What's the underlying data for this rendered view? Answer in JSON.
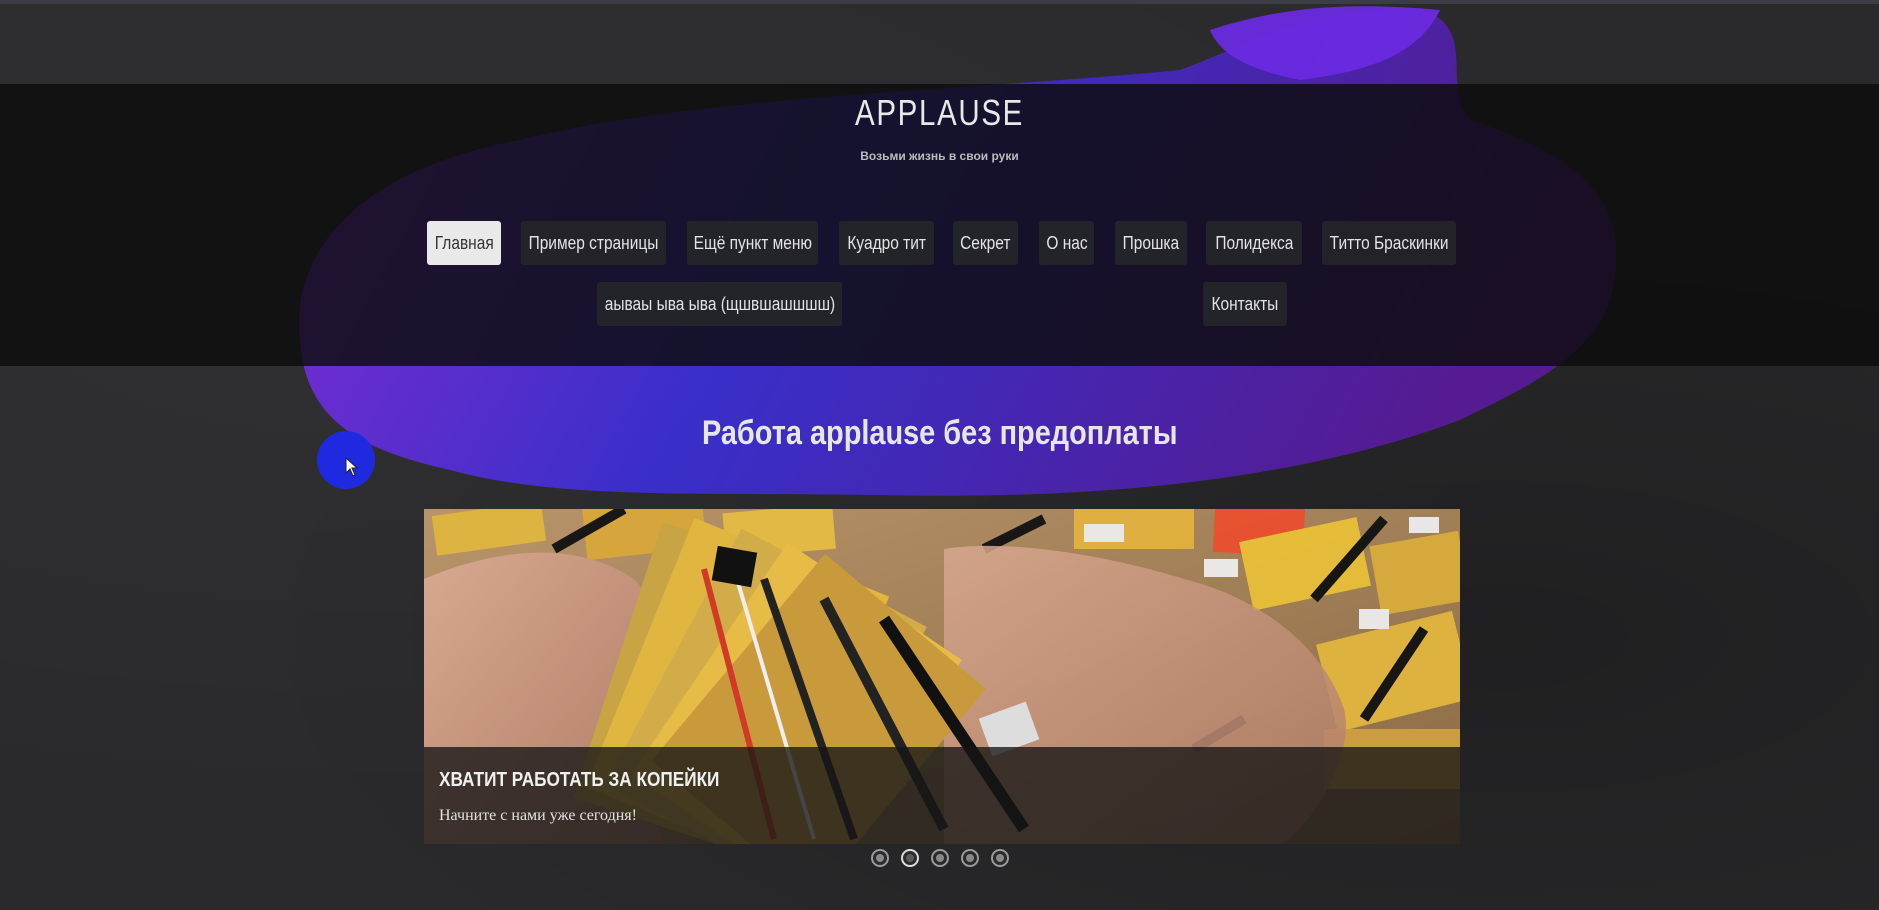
{
  "site": {
    "title": "APPLAUSE",
    "tagline": "Возьми жизнь в свои руки"
  },
  "nav": {
    "items": [
      {
        "label": "Главная",
        "active": true
      },
      {
        "label": "Пример страницы"
      },
      {
        "label": "Ещё пункт меню"
      },
      {
        "label": "Куадро тит"
      },
      {
        "label": "Секрет"
      },
      {
        "label": "О нас"
      },
      {
        "label": "Прошка"
      },
      {
        "label": "Полидекса"
      },
      {
        "label": "Титто Браскинки"
      },
      {
        "label": "аываы ыва ыва (щшвшашшшш)"
      },
      {
        "label": "Контакты"
      }
    ]
  },
  "main": {
    "headline": "Работа applause без предоплаты"
  },
  "slider": {
    "caption_title": "ХВАТИТ РАБОТАТЬ ЗА КОПЕЙКИ",
    "caption_text": "Начните с нами уже сегодня!",
    "slide_count": 5,
    "active_slide": 2
  },
  "colors": {
    "brush_purple": "#7a2fd8",
    "brush_blue": "#2a2fd0",
    "cursor_marker": "#1f2ae0",
    "header_band": "#0c0c0c"
  }
}
